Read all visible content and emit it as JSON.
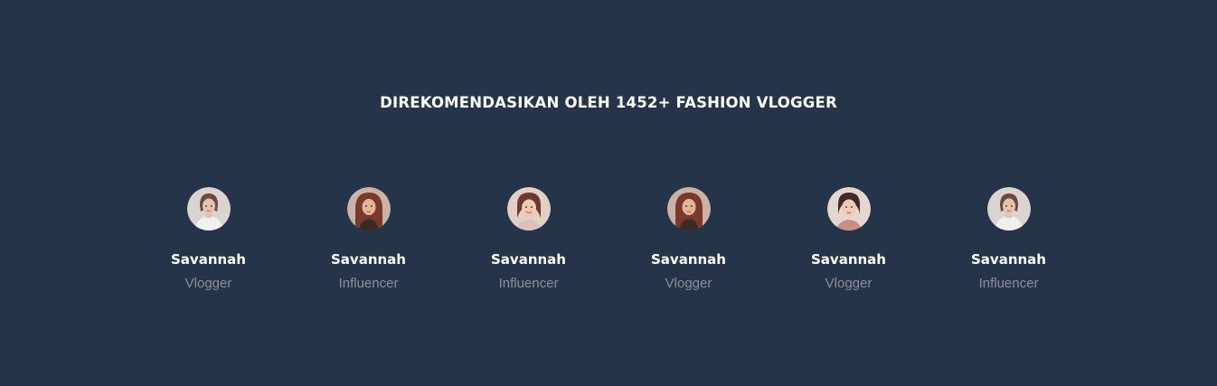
{
  "section": {
    "heading": "DIREKOMENDASIKAN OLEH 1452+ FASHION VLOGGER"
  },
  "colors": {
    "background": "#253449",
    "heading": "#ffffff",
    "name": "#ffffff",
    "role": "#8e8e98"
  },
  "people": [
    {
      "name": "Savannah",
      "role": "Vlogger",
      "avatar": "woman-portrait-light-icon"
    },
    {
      "name": "Savannah",
      "role": "Influencer",
      "avatar": "woman-portrait-red-hair-icon"
    },
    {
      "name": "Savannah",
      "role": "Influencer",
      "avatar": "woman-portrait-smiling-icon"
    },
    {
      "name": "Savannah",
      "role": "Vlogger",
      "avatar": "woman-portrait-red-hair-icon"
    },
    {
      "name": "Savannah",
      "role": "Vlogger",
      "avatar": "woman-portrait-dark-hair-icon"
    },
    {
      "name": "Savannah",
      "role": "Influencer",
      "avatar": "woman-portrait-light-icon"
    }
  ]
}
